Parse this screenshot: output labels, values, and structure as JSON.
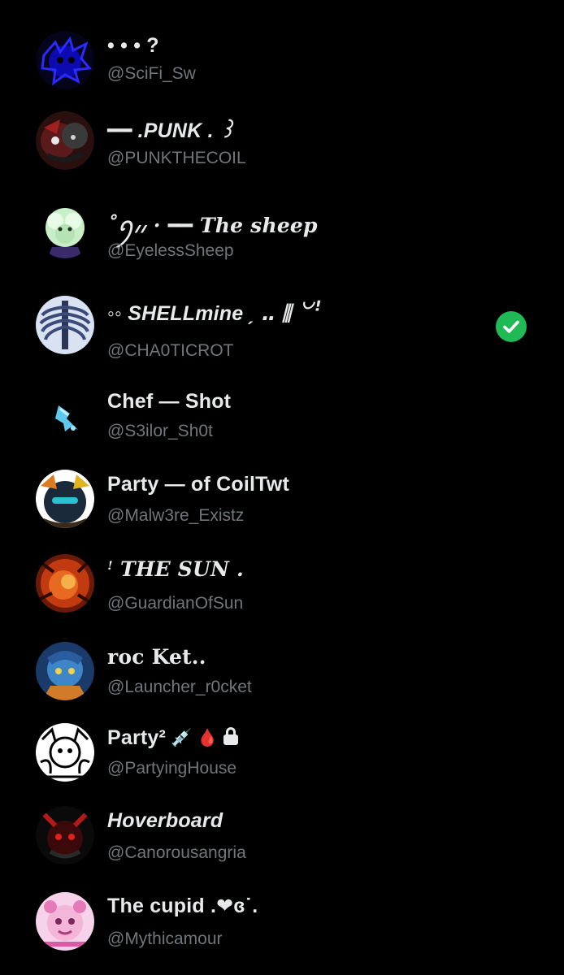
{
  "following_list": [
    {
      "display_name": "• • • ?",
      "handle": "@SciFi_Sw"
    },
    {
      "display_name": "━━ .PUNK . ꒱",
      "handle": "@PUNKTHECOIL"
    },
    {
      "display_name": "˚ꪆ៸៸ · ━━ The sheep",
      "handle": "@EyelessSheep"
    },
    {
      "display_name": "◦◦ SHELLmine ˏ ‥ ⫼ ꒡ꜝ",
      "handle": "@CHA0TICROT",
      "selected": true
    },
    {
      "display_name": "Chef — Shot",
      "handle": "@S3ilor_Sh0t"
    },
    {
      "display_name": "Party — of CoilTwt",
      "handle": "@Malw3re_Existz"
    },
    {
      "display_name": "ꜝ THE SUN .",
      "handle": "@GuardianOfSun"
    },
    {
      "display_name": "roc Ket..",
      "handle": "@Launcher_r0cket"
    },
    {
      "display_name": "Party²",
      "handle": "@PartyingHouse",
      "suffix_icons": [
        "syringe-icon",
        "drop-of-blood-icon",
        "lock-icon"
      ]
    },
    {
      "display_name": "Hoverboard",
      "handle": "@Canorousangria"
    },
    {
      "display_name": "The cupid .❤︎ɞ˙.",
      "handle": "@Mythicamour"
    }
  ],
  "selection_badge": {
    "icon": "check-icon",
    "color": "#1fb956"
  },
  "colors": {
    "background": "#000000",
    "name": "#e7e9ea",
    "handle": "#71767b"
  },
  "icons": {
    "syringe": "💉",
    "drop_of_blood": "🩸"
  }
}
